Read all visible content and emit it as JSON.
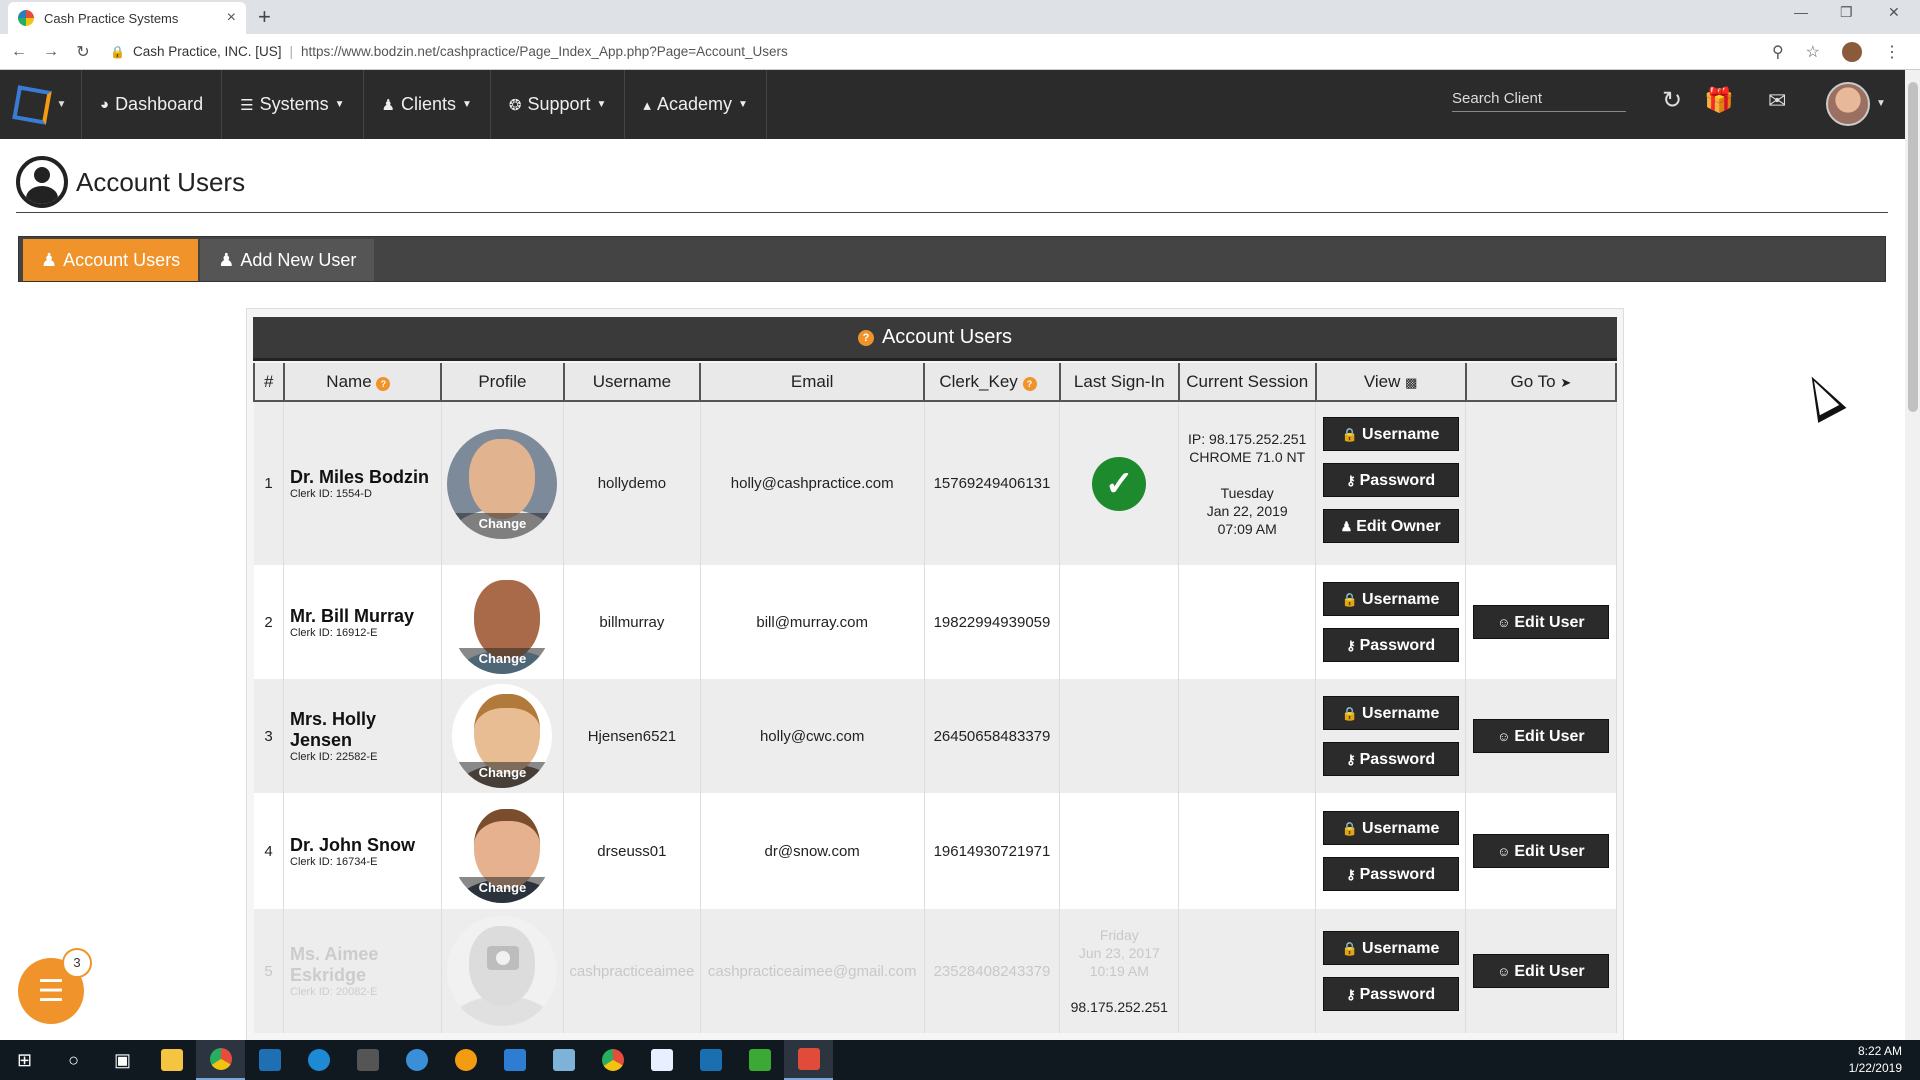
{
  "browser": {
    "tab_title": "Cash Practice Systems",
    "tab_close": "×",
    "new_tab": "+",
    "org": "Cash Practice, INC. [US]",
    "url": "https://www.bodzin.net/cashpractice/Page_Index_App.php?Page=Account_Users"
  },
  "nav": {
    "items": [
      {
        "icon": "dashboard-icon",
        "label": "Dashboard"
      },
      {
        "icon": "sitemap-icon",
        "label": "Systems"
      },
      {
        "icon": "users-icon",
        "label": "Clients"
      },
      {
        "icon": "support-icon",
        "label": "Support"
      },
      {
        "icon": "graduation-cap-icon",
        "label": "Academy"
      }
    ],
    "search_placeholder": "Search Client"
  },
  "page": {
    "title": "Account Users",
    "tabs": [
      {
        "label": "Account Users",
        "active": true
      },
      {
        "label": "Add New User",
        "active": false
      }
    ],
    "panel_title": "Account Users"
  },
  "table": {
    "headers": [
      "#",
      "Name",
      "Profile",
      "Username",
      "Email",
      "Clerk_Key",
      "Last Sign-In",
      "Current Session",
      "View",
      "Go To"
    ],
    "change_label": "Change",
    "btn_username": "Username",
    "btn_password": "Password",
    "btn_edit_owner": "Edit Owner",
    "btn_edit_user": "Edit User",
    "rows": [
      {
        "num": "1",
        "name": "Dr. Miles Bodzin",
        "clerk_id": "Clerk ID: 1554-D",
        "username": "hollydemo",
        "email": "holly@cashpractice.com",
        "clerk_key": "15769249406131",
        "signed_in": true,
        "session": {
          "ip": "IP: 98.175.252.251",
          "browser": "CHROME 71.0 NT",
          "day": "Tuesday",
          "date": "Jan 22, 2019",
          "time": "07:09 AM"
        }
      },
      {
        "num": "2",
        "name": "Mr. Bill Murray",
        "clerk_id": "Clerk ID: 16912-E",
        "username": "billmurray",
        "email": "bill@murray.com",
        "clerk_key": "19822994939059"
      },
      {
        "num": "3",
        "name": "Mrs. Holly Jensen",
        "clerk_id": "Clerk ID: 22582-E",
        "username": "Hjensen6521",
        "email": "holly@cwc.com",
        "clerk_key": "26450658483379"
      },
      {
        "num": "4",
        "name": "Dr. John Snow",
        "clerk_id": "Clerk ID: 16734-E",
        "username": "drseuss01",
        "email": "dr@snow.com",
        "clerk_key": "19614930721971"
      },
      {
        "num": "5",
        "name": "Ms. Aimee Eskridge",
        "clerk_id": "Clerk ID: 20082-E",
        "username": "cashpracticeaimee",
        "email": "cashpracticeaimee@gmail.com",
        "clerk_key": "23528408243379",
        "last_signin": {
          "day": "Friday",
          "date": "Jun 23, 2017",
          "time": "10:19 AM",
          "ip": "98.175.252.251"
        }
      }
    ]
  },
  "float_badge": "3",
  "clock": {
    "time": "8:22 AM",
    "date": "1/22/2019"
  },
  "colors": {
    "accent": "#f0932b",
    "nav_bg": "#2b2b2b",
    "success": "#1e8a2e"
  }
}
